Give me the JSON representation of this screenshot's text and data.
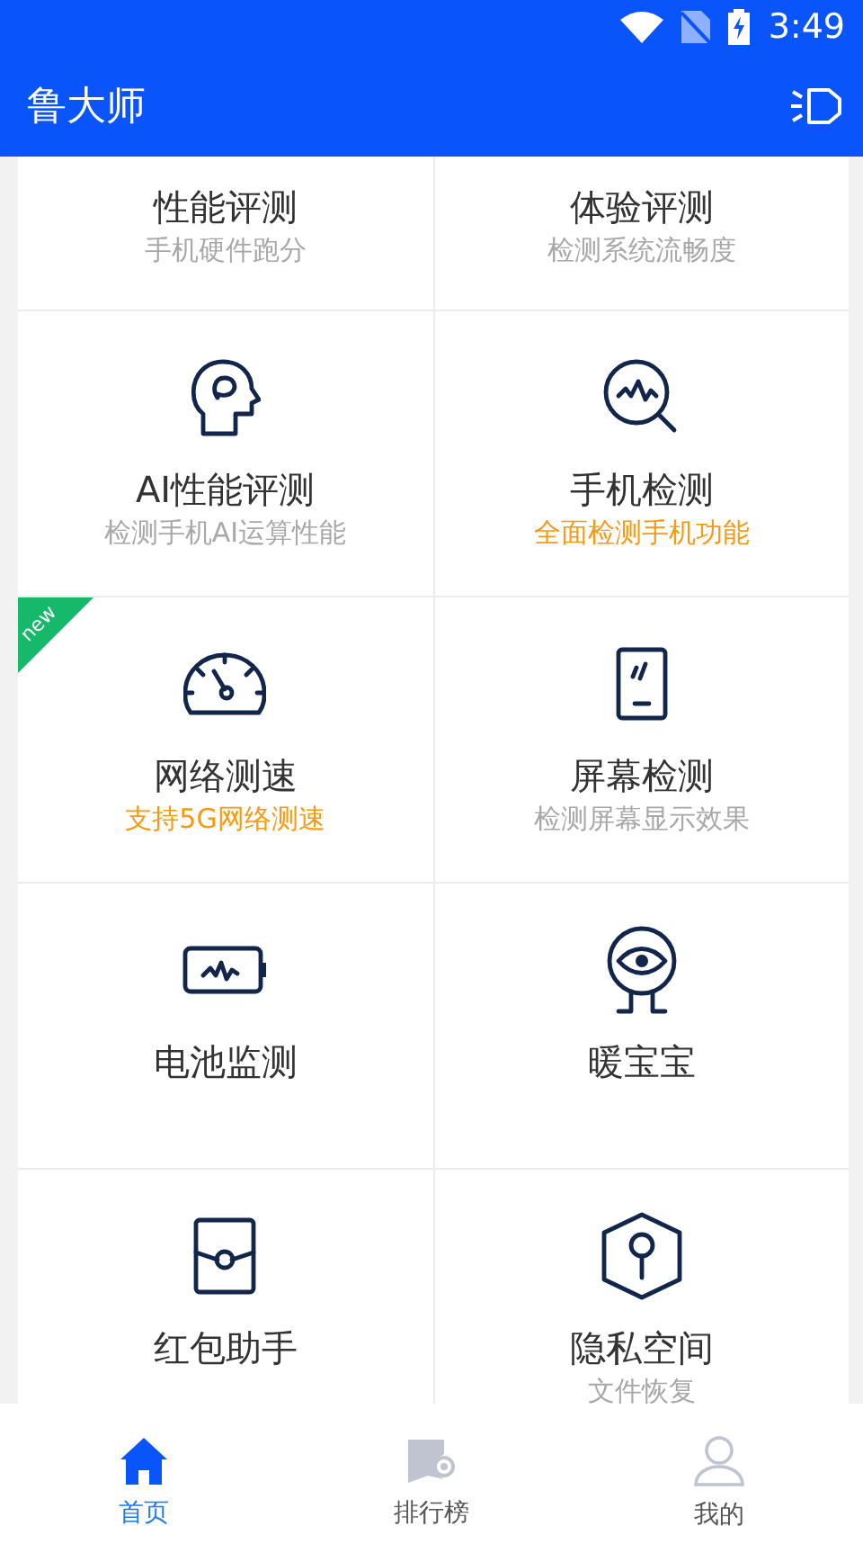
{
  "status_bar": {
    "time": "3:49"
  },
  "app_bar": {
    "title": "鲁大师"
  },
  "tiles": [
    {
      "kind": "partial",
      "title": "性能评测",
      "subtitle": "手机硬件跑分",
      "highlighted": false
    },
    {
      "kind": "partial",
      "title": "体验评测",
      "subtitle": "检测系统流畅度",
      "highlighted": false
    },
    {
      "kind": "full",
      "title": "AI性能评测",
      "subtitle": "检测手机AI运算性能",
      "highlighted": false
    },
    {
      "kind": "full",
      "title": "手机检测",
      "subtitle": "全面检测手机功能",
      "highlighted": true
    },
    {
      "kind": "full",
      "title": "网络测速",
      "subtitle": "支持5G网络测速",
      "highlighted": true,
      "badge": "new"
    },
    {
      "kind": "full",
      "title": "屏幕检测",
      "subtitle": "检测屏幕显示效果",
      "highlighted": false
    },
    {
      "kind": "full",
      "title": "电池监测"
    },
    {
      "kind": "full",
      "title": "暖宝宝"
    },
    {
      "kind": "full",
      "title": "红包助手"
    },
    {
      "kind": "full",
      "title": "隐私空间",
      "subtitle": "文件恢复",
      "highlighted": false
    }
  ],
  "bottom_nav": [
    {
      "label": "首页",
      "selected": true
    },
    {
      "label": "排行榜",
      "selected": false
    },
    {
      "label": "我的",
      "selected": false
    }
  ]
}
